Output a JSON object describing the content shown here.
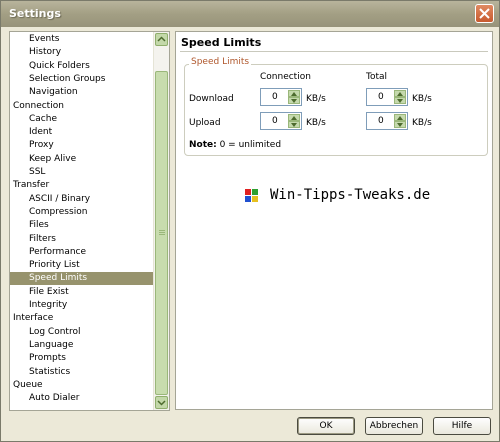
{
  "window": {
    "title": "Settings",
    "close_icon": "close-icon"
  },
  "tree": {
    "items": [
      {
        "label": "Events",
        "level": "child"
      },
      {
        "label": "History",
        "level": "child"
      },
      {
        "label": "Quick Folders",
        "level": "child"
      },
      {
        "label": "Selection Groups",
        "level": "child"
      },
      {
        "label": "Navigation",
        "level": "child"
      },
      {
        "label": "Connection",
        "level": "cat"
      },
      {
        "label": "Cache",
        "level": "child"
      },
      {
        "label": "Ident",
        "level": "child"
      },
      {
        "label": "Proxy",
        "level": "child"
      },
      {
        "label": "Keep Alive",
        "level": "child"
      },
      {
        "label": "SSL",
        "level": "child"
      },
      {
        "label": "Transfer",
        "level": "cat"
      },
      {
        "label": "ASCII / Binary",
        "level": "child"
      },
      {
        "label": "Compression",
        "level": "child"
      },
      {
        "label": "Files",
        "level": "child"
      },
      {
        "label": "Filters",
        "level": "child"
      },
      {
        "label": "Performance",
        "level": "child"
      },
      {
        "label": "Priority List",
        "level": "child"
      },
      {
        "label": "Speed Limits",
        "level": "child",
        "selected": true
      },
      {
        "label": "File Exist",
        "level": "child"
      },
      {
        "label": "Integrity",
        "level": "child"
      },
      {
        "label": "Interface",
        "level": "cat"
      },
      {
        "label": "Log Control",
        "level": "child"
      },
      {
        "label": "Language",
        "level": "child"
      },
      {
        "label": "Prompts",
        "level": "child"
      },
      {
        "label": "Statistics",
        "level": "child"
      },
      {
        "label": "Queue",
        "level": "cat"
      },
      {
        "label": "Auto Dialer",
        "level": "child"
      }
    ]
  },
  "panel": {
    "header": "Speed Limits",
    "group_title": "Speed Limits",
    "col_connection": "Connection",
    "col_total": "Total",
    "row_download": "Download",
    "row_upload": "Upload",
    "download_connection": "0",
    "download_total": "0",
    "upload_connection": "0",
    "upload_total": "0",
    "unit": "KB/s",
    "note_bold": "Note:",
    "note_text": " 0 = unlimited"
  },
  "watermark": {
    "text": "Win-Tipps-Tweaks.de"
  },
  "buttons": {
    "ok": "OK",
    "cancel": "Abbrechen",
    "help": "Hilfe"
  }
}
